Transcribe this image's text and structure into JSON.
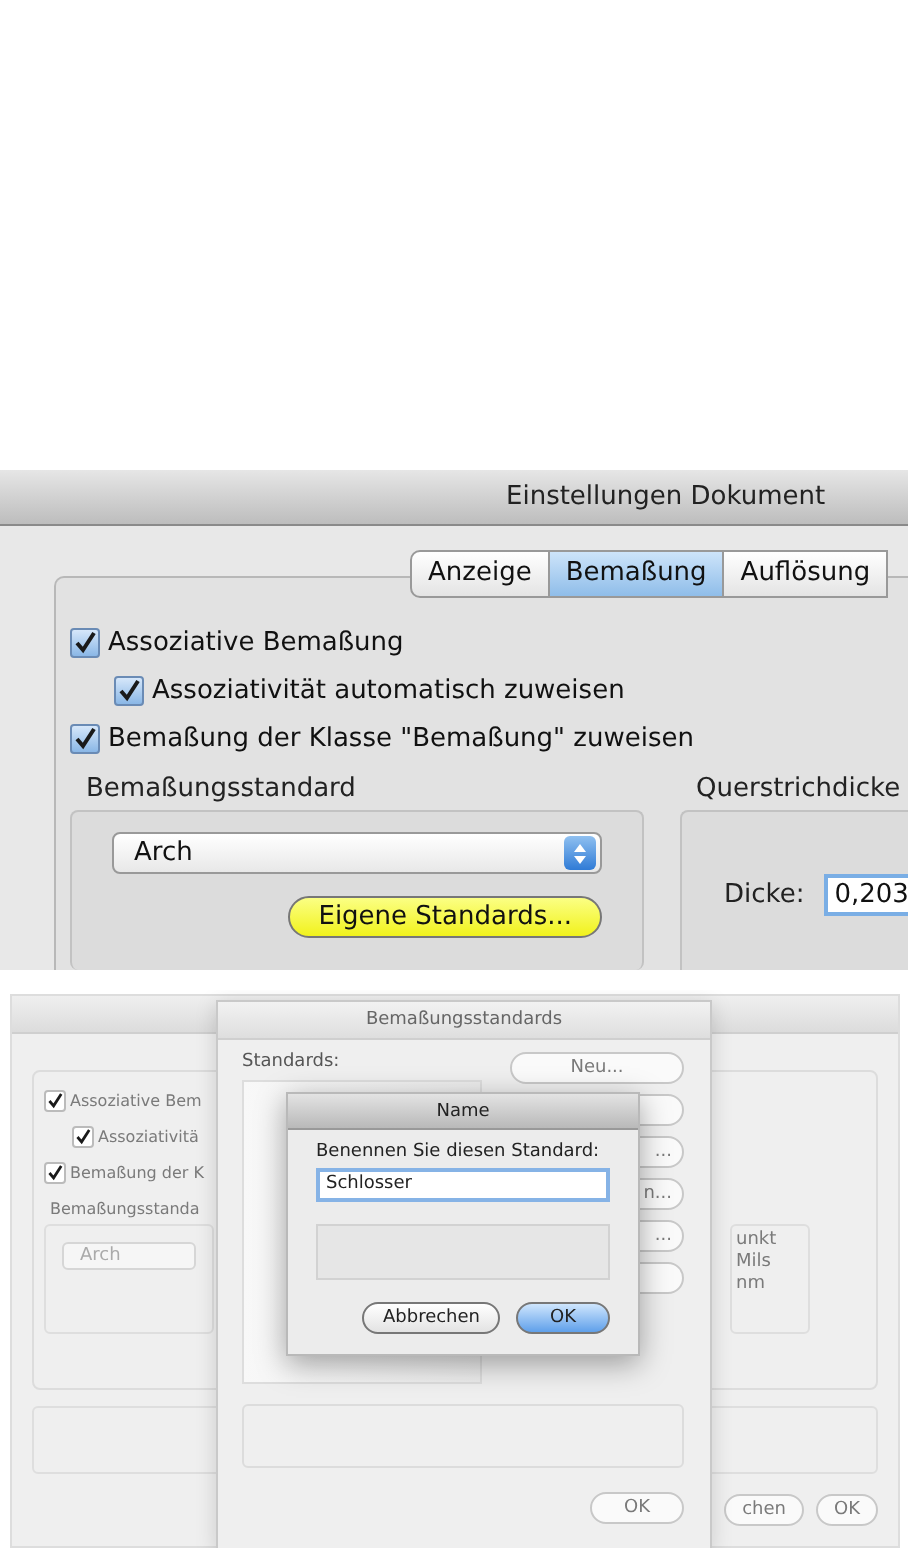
{
  "settings_window": {
    "title": "Einstellungen Dokument",
    "tabs": [
      {
        "label": "Anzeige",
        "selected": false
      },
      {
        "label": "Bemaßung",
        "selected": true
      },
      {
        "label": "Auflösung",
        "selected": false
      }
    ],
    "checkboxes": [
      {
        "label": "Assoziative Bemaßung",
        "checked": true,
        "children": [
          {
            "label": "Assoziativität automatisch zuweisen",
            "checked": true
          }
        ]
      },
      {
        "label": "Bemaßung der Klasse \"Bemaßung\" zuweisen",
        "checked": true
      }
    ],
    "standard_group": {
      "title": "Bemaßungsstandard",
      "popup": "Arch",
      "button": "Eigene Standards..."
    },
    "thickness_group": {
      "title": "Querstrichdicke",
      "label": "Dicke:",
      "value": "0,203"
    }
  },
  "background_window": {
    "checkboxes": [
      {
        "label": "Assoziative Bem",
        "checked": true,
        "children": [
          {
            "label": "Assoziativitä",
            "checked": true
          }
        ]
      },
      {
        "label": "Bemaßung der K",
        "checked": true
      }
    ],
    "group_title": "Bemaßungsstanda",
    "popup": "Arch",
    "unit_options": [
      "unkt",
      "Mils",
      "nm"
    ],
    "buttons": [
      "chen",
      "OK"
    ]
  },
  "standards_dialog": {
    "title": "Bemaßungsstandards",
    "list_label": "Standards:",
    "side_buttons": [
      {
        "kind": "labeled",
        "label": "Neu..."
      },
      {
        "kind": "blank"
      },
      {
        "kind": "labeled",
        "label": "..."
      },
      {
        "kind": "labeled",
        "label": "n..."
      },
      {
        "kind": "labeled",
        "label": "..."
      },
      {
        "kind": "blank"
      }
    ],
    "ok_button": "OK"
  },
  "name_dialog": {
    "title": "Name",
    "prompt": "Benennen Sie diesen Standard:",
    "value": "Schlosser",
    "buttons": [
      {
        "label": "Abbrechen",
        "default": false
      },
      {
        "label": "OK",
        "default": true
      }
    ]
  }
}
